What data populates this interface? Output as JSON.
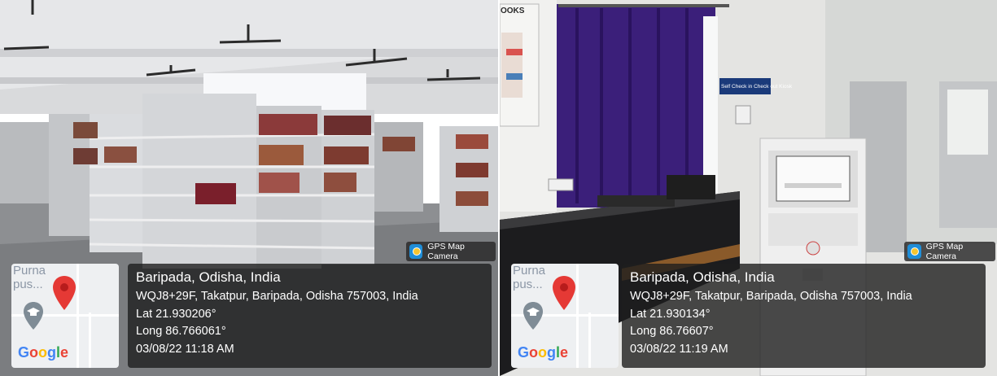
{
  "photos": [
    {
      "badge": {
        "icon": "gps-map-camera-icon",
        "label": "GPS Map Camera"
      },
      "map": {
        "partial_text": "Purna\npus...",
        "logo": "Google"
      },
      "place": "Baripada, Odisha, India",
      "address": "WQJ8+29F, Takatpur, Baripada, Odisha 757003, India",
      "lat": "Lat 21.930206°",
      "long": "Long 86.766061°",
      "datetime": "03/08/22 11:18 AM"
    },
    {
      "badge": {
        "icon": "gps-map-camera-icon",
        "label": "GPS Map Camera"
      },
      "map": {
        "partial_text": "Purna\npus...",
        "logo": "Google"
      },
      "place": "Baripada, Odisha, India",
      "address": "WQJ8+29F, Takatpur, Baripada, Odisha 757003, India",
      "lat": "Lat 21.930134°",
      "long": "Long 86.76607°",
      "datetime": "03/08/22 11:19 AM"
    }
  ],
  "scene_signs": {
    "books_sign": "OOKS",
    "kiosk_sign": "Self Check in Check out Kiosk"
  },
  "colors": {
    "overlay": "#1e1e1e",
    "pin": "#e53935",
    "google_blue": "#4285f4",
    "google_red": "#ea4335",
    "google_yellow": "#fbbc05",
    "google_green": "#34a853",
    "curtain": "#3b1f7a"
  }
}
